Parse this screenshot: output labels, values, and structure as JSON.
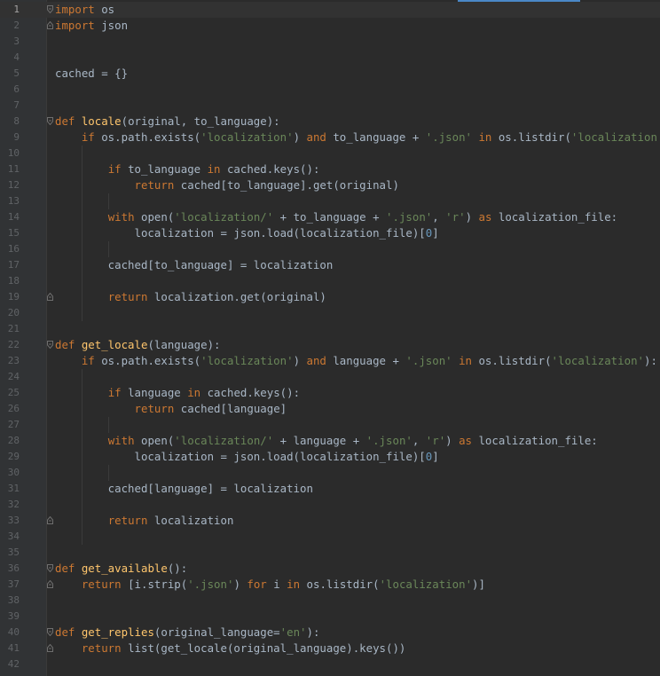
{
  "editor": {
    "language": "python",
    "current_line": 1,
    "colors": {
      "background": "#2b2b2b",
      "gutter": "#313335",
      "default": "#a9b7c6",
      "keyword": "#cc7832",
      "function": "#ffc66d",
      "string": "#6a8759",
      "number": "#6897bb",
      "line_number": "#606366"
    },
    "lines": [
      {
        "n": "1",
        "fold": "open",
        "tokens": [
          [
            "kw",
            "import"
          ],
          [
            "t",
            " os"
          ]
        ]
      },
      {
        "n": "2",
        "fold": "close",
        "tokens": [
          [
            "kw",
            "import"
          ],
          [
            "t",
            " json"
          ]
        ]
      },
      {
        "n": "3",
        "tokens": []
      },
      {
        "n": "4",
        "tokens": []
      },
      {
        "n": "5",
        "tokens": [
          [
            "t",
            "cached = {}"
          ]
        ]
      },
      {
        "n": "6",
        "tokens": []
      },
      {
        "n": "7",
        "tokens": []
      },
      {
        "n": "8",
        "fold": "open",
        "tokens": [
          [
            "kw",
            "def "
          ],
          [
            "fn",
            "locale"
          ],
          [
            "t",
            "(original, to_language):"
          ]
        ]
      },
      {
        "n": "9",
        "tokens": [
          [
            "t",
            "    "
          ],
          [
            "kw",
            "if"
          ],
          [
            "t",
            " os.path.exists("
          ],
          [
            "str",
            "'localization'"
          ],
          [
            "t",
            ") "
          ],
          [
            "kw",
            "and"
          ],
          [
            "t",
            " to_language + "
          ],
          [
            "str",
            "'.json'"
          ],
          [
            "t",
            " "
          ],
          [
            "kw",
            "in"
          ],
          [
            "t",
            " os.listdir("
          ],
          [
            "str",
            "'localization'"
          ],
          [
            "t",
            "):"
          ]
        ]
      },
      {
        "n": "10",
        "tokens": []
      },
      {
        "n": "11",
        "tokens": [
          [
            "t",
            "        "
          ],
          [
            "kw",
            "if"
          ],
          [
            "t",
            " to_language "
          ],
          [
            "kw",
            "in"
          ],
          [
            "t",
            " cached.keys():"
          ]
        ]
      },
      {
        "n": "12",
        "tokens": [
          [
            "t",
            "            "
          ],
          [
            "kw",
            "return"
          ],
          [
            "t",
            " cached[to_language].get(original)"
          ]
        ]
      },
      {
        "n": "13",
        "tokens": []
      },
      {
        "n": "14",
        "tokens": [
          [
            "t",
            "        "
          ],
          [
            "kw",
            "with"
          ],
          [
            "t",
            " open("
          ],
          [
            "str",
            "'localization/'"
          ],
          [
            "t",
            " + to_language + "
          ],
          [
            "str",
            "'.json'"
          ],
          [
            "t",
            ", "
          ],
          [
            "str",
            "'r'"
          ],
          [
            "t",
            ") "
          ],
          [
            "kw",
            "as"
          ],
          [
            "t",
            " localization_file:"
          ]
        ]
      },
      {
        "n": "15",
        "tokens": [
          [
            "t",
            "            localization = json.load(localization_file)["
          ],
          [
            "num",
            "0"
          ],
          [
            "t",
            "]"
          ]
        ]
      },
      {
        "n": "16",
        "tokens": []
      },
      {
        "n": "17",
        "tokens": [
          [
            "t",
            "        cached[to_language] = localization"
          ]
        ]
      },
      {
        "n": "18",
        "tokens": []
      },
      {
        "n": "19",
        "fold": "close",
        "tokens": [
          [
            "t",
            "        "
          ],
          [
            "kw",
            "return"
          ],
          [
            "t",
            " localization.get(original)"
          ]
        ]
      },
      {
        "n": "20",
        "tokens": []
      },
      {
        "n": "21",
        "tokens": []
      },
      {
        "n": "22",
        "fold": "open",
        "tokens": [
          [
            "kw",
            "def "
          ],
          [
            "fn",
            "get_locale"
          ],
          [
            "t",
            "(language):"
          ]
        ]
      },
      {
        "n": "23",
        "tokens": [
          [
            "t",
            "    "
          ],
          [
            "kw",
            "if"
          ],
          [
            "t",
            " os.path.exists("
          ],
          [
            "str",
            "'localization'"
          ],
          [
            "t",
            ") "
          ],
          [
            "kw",
            "and"
          ],
          [
            "t",
            " language + "
          ],
          [
            "str",
            "'.json'"
          ],
          [
            "t",
            " "
          ],
          [
            "kw",
            "in"
          ],
          [
            "t",
            " os.listdir("
          ],
          [
            "str",
            "'localization'"
          ],
          [
            "t",
            "):"
          ]
        ]
      },
      {
        "n": "24",
        "tokens": []
      },
      {
        "n": "25",
        "tokens": [
          [
            "t",
            "        "
          ],
          [
            "kw",
            "if"
          ],
          [
            "t",
            " language "
          ],
          [
            "kw",
            "in"
          ],
          [
            "t",
            " cached.keys():"
          ]
        ]
      },
      {
        "n": "26",
        "tokens": [
          [
            "t",
            "            "
          ],
          [
            "kw",
            "return"
          ],
          [
            "t",
            " cached[language]"
          ]
        ]
      },
      {
        "n": "27",
        "tokens": []
      },
      {
        "n": "28",
        "tokens": [
          [
            "t",
            "        "
          ],
          [
            "kw",
            "with"
          ],
          [
            "t",
            " open("
          ],
          [
            "str",
            "'localization/'"
          ],
          [
            "t",
            " + language + "
          ],
          [
            "str",
            "'.json'"
          ],
          [
            "t",
            ", "
          ],
          [
            "str",
            "'r'"
          ],
          [
            "t",
            ") "
          ],
          [
            "kw",
            "as"
          ],
          [
            "t",
            " localization_file:"
          ]
        ]
      },
      {
        "n": "29",
        "tokens": [
          [
            "t",
            "            localization = json.load(localization_file)["
          ],
          [
            "num",
            "0"
          ],
          [
            "t",
            "]"
          ]
        ]
      },
      {
        "n": "30",
        "tokens": []
      },
      {
        "n": "31",
        "tokens": [
          [
            "t",
            "        cached[language] = localization"
          ]
        ]
      },
      {
        "n": "32",
        "tokens": []
      },
      {
        "n": "33",
        "fold": "close",
        "tokens": [
          [
            "t",
            "        "
          ],
          [
            "kw",
            "return"
          ],
          [
            "t",
            " localization"
          ]
        ]
      },
      {
        "n": "34",
        "tokens": []
      },
      {
        "n": "35",
        "tokens": []
      },
      {
        "n": "36",
        "fold": "open",
        "tokens": [
          [
            "kw",
            "def "
          ],
          [
            "fn",
            "get_available"
          ],
          [
            "t",
            "():"
          ]
        ]
      },
      {
        "n": "37",
        "fold": "close",
        "tokens": [
          [
            "t",
            "    "
          ],
          [
            "kw",
            "return"
          ],
          [
            "t",
            " [i.strip("
          ],
          [
            "str",
            "'.json'"
          ],
          [
            "t",
            ") "
          ],
          [
            "kw",
            "for"
          ],
          [
            "t",
            " i "
          ],
          [
            "kw",
            "in"
          ],
          [
            "t",
            " os.listdir("
          ],
          [
            "str",
            "'localization'"
          ],
          [
            "t",
            ")]"
          ]
        ]
      },
      {
        "n": "38",
        "tokens": []
      },
      {
        "n": "39",
        "tokens": []
      },
      {
        "n": "40",
        "fold": "open",
        "tokens": [
          [
            "kw",
            "def "
          ],
          [
            "fn",
            "get_replies"
          ],
          [
            "t",
            "(original_language="
          ],
          [
            "str",
            "'en'"
          ],
          [
            "t",
            "):"
          ]
        ]
      },
      {
        "n": "41",
        "fold": "close",
        "tokens": [
          [
            "t",
            "    "
          ],
          [
            "kw",
            "return"
          ],
          [
            "t",
            " list(get_locale(original_language).keys())"
          ]
        ]
      },
      {
        "n": "42",
        "tokens": []
      }
    ]
  }
}
